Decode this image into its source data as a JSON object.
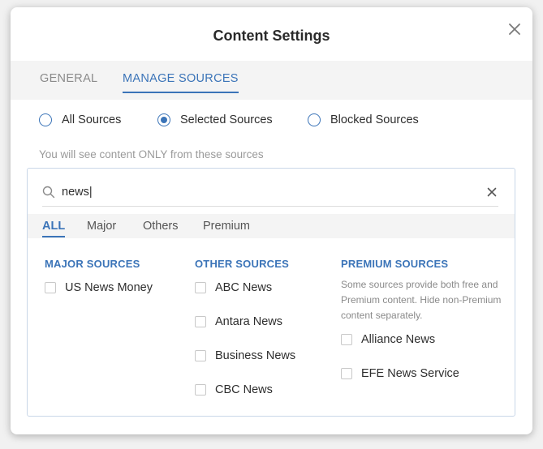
{
  "dialog": {
    "title": "Content Settings"
  },
  "top_tabs": {
    "general": "GENERAL",
    "manage_sources": "MANAGE SOURCES",
    "active": "manage_sources"
  },
  "source_mode": {
    "options": [
      "All Sources",
      "Selected Sources",
      "Blocked Sources"
    ],
    "selected": "Selected Sources"
  },
  "hint": "You will see content ONLY from these sources",
  "search": {
    "value": "news|",
    "icon": "search-icon",
    "clear_icon": "close-icon"
  },
  "filter_tabs": {
    "items": [
      "ALL",
      "Major",
      "Others",
      "Premium"
    ],
    "active": "ALL"
  },
  "columns": {
    "major": {
      "heading": "MAJOR SOURCES",
      "items": [
        "US News Money"
      ]
    },
    "other": {
      "heading": "OTHER SOURCES",
      "items": [
        "ABC News",
        "Antara News",
        "Business News",
        "CBC News"
      ]
    },
    "premium": {
      "heading": "PREMIUM SOURCES",
      "description": "Some sources provide both free and Premium content. Hide non-Premium content separately.",
      "items": [
        "Alliance News",
        "EFE News Service"
      ]
    }
  },
  "colors": {
    "accent": "#3b74b8",
    "tab_bar": "#f4f4f4",
    "muted_text": "#9a9a9a"
  }
}
